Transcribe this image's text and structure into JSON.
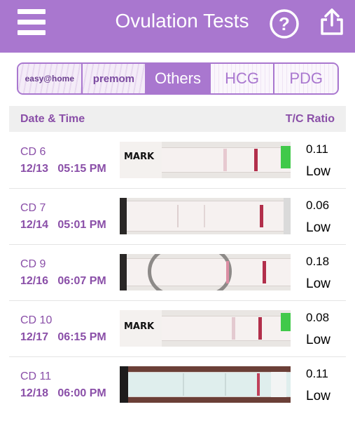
{
  "header": {
    "title": "Ovulation Tests",
    "menu_icon": "hamburger-menu-icon",
    "help_icon": "help-question-icon",
    "share_icon": "share-upload-icon",
    "background_color": "#a977cf"
  },
  "tabs": [
    {
      "label": "easy@home",
      "kind": "logo"
    },
    {
      "label": "premom",
      "kind": "logo"
    },
    {
      "label": "Others",
      "active": true
    },
    {
      "label": "HCG"
    },
    {
      "label": "PDG"
    }
  ],
  "list_header": {
    "left": "Date & Time",
    "right": "T/C Ratio"
  },
  "rows": [
    {
      "cd": "CD 6",
      "date": "12/13",
      "time": "05:15 PM",
      "ratio": "0.11",
      "level": "Low",
      "strip_label": "MARK"
    },
    {
      "cd": "CD 7",
      "date": "12/14",
      "time": "05:01 PM",
      "ratio": "0.06",
      "level": "Low"
    },
    {
      "cd": "CD 9",
      "date": "12/16",
      "time": "06:07 PM",
      "ratio": "0.18",
      "level": "Low"
    },
    {
      "cd": "CD 10",
      "date": "12/17",
      "time": "06:15 PM",
      "ratio": "0.08",
      "level": "Low",
      "strip_label": "MARK"
    },
    {
      "cd": "CD 11",
      "date": "12/18",
      "time": "06:00 PM",
      "ratio": "0.11",
      "level": "Low"
    }
  ]
}
